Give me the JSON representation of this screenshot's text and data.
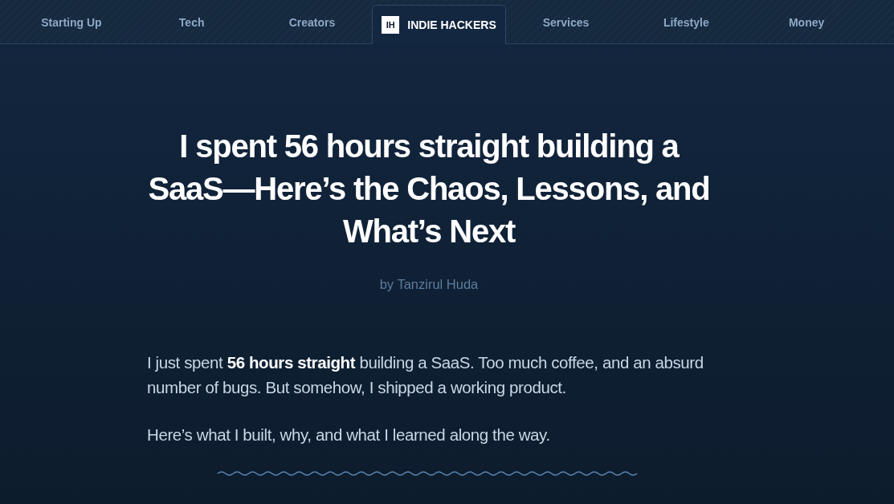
{
  "nav": {
    "tabs": [
      {
        "label": "Starting Up",
        "selected": false
      },
      {
        "label": "Tech",
        "selected": false
      },
      {
        "label": "Creators",
        "selected": false
      },
      {
        "label": "INDIE HACKERS",
        "logo": "IH",
        "selected": true
      },
      {
        "label": "Services",
        "selected": false
      },
      {
        "label": "Lifestyle",
        "selected": false
      },
      {
        "label": "Money",
        "selected": false
      }
    ]
  },
  "article": {
    "title": "I spent 56 hours straight building a SaaS—Here’s the Chaos, Lessons, and What’s Next",
    "byline": "by Tanzirul Huda",
    "paragraphs": [
      "I just spent **56 hours straight** building a SaaS. Too much coffee, and an absurd number of bugs. But somehow, I shipped a working product.",
      "Here’s what I built, why, and what I learned along the way."
    ]
  }
}
